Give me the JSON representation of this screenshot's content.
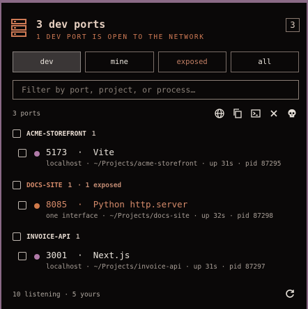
{
  "header": {
    "icon": "server-stack-icon",
    "title": "3 dev ports",
    "subtitle": "1 DEV PORT IS OPEN TO THE NETWORK",
    "badge": "3"
  },
  "tabs": [
    {
      "label": "dev",
      "active": true
    },
    {
      "label": "mine",
      "active": false
    },
    {
      "label": "exposed",
      "active": false
    },
    {
      "label": "all",
      "active": false
    }
  ],
  "filter": {
    "placeholder": "Filter by port, project, or process…",
    "value": ""
  },
  "list": {
    "count_label": "3 ports"
  },
  "toolbar": [
    "globe-icon",
    "copy-icon",
    "terminal-icon",
    "close-icon",
    "skull-icon"
  ],
  "groups": [
    {
      "name": "ACME-STOREFRONT",
      "count": "1",
      "exposed_label": "",
      "exposed": false,
      "items": [
        {
          "port": "5173",
          "sep": "·",
          "process": "Vite",
          "meta": "localhost · ~/Projects/acme-storefront · up 31s · pid 87295",
          "status_color": "#b07aa8"
        }
      ]
    },
    {
      "name": "DOCS-SITE",
      "count": "1",
      "exposed_label": "· 1 exposed",
      "exposed": true,
      "items": [
        {
          "port": "8085",
          "sep": "·",
          "process": "Python http.server",
          "meta": "one interface · ~/Projects/docs-site · up 32s · pid 87298",
          "status_color": "#d07a4a"
        }
      ]
    },
    {
      "name": "INVOICE-API",
      "count": "1",
      "exposed_label": "",
      "exposed": false,
      "items": [
        {
          "port": "3001",
          "sep": "·",
          "process": "Next.js",
          "meta": "localhost · ~/Projects/invoice-api · up 31s · pid 87297",
          "status_color": "#b07aa8"
        }
      ]
    }
  ],
  "footer": {
    "summary": "10 listening · 5 yours",
    "refresh_icon": "refresh-icon"
  },
  "colors": {
    "accent": "#cf7a55",
    "exposed": "#d48a6a",
    "panel_bg": "#0a0808",
    "frame": "#8a6a86"
  }
}
